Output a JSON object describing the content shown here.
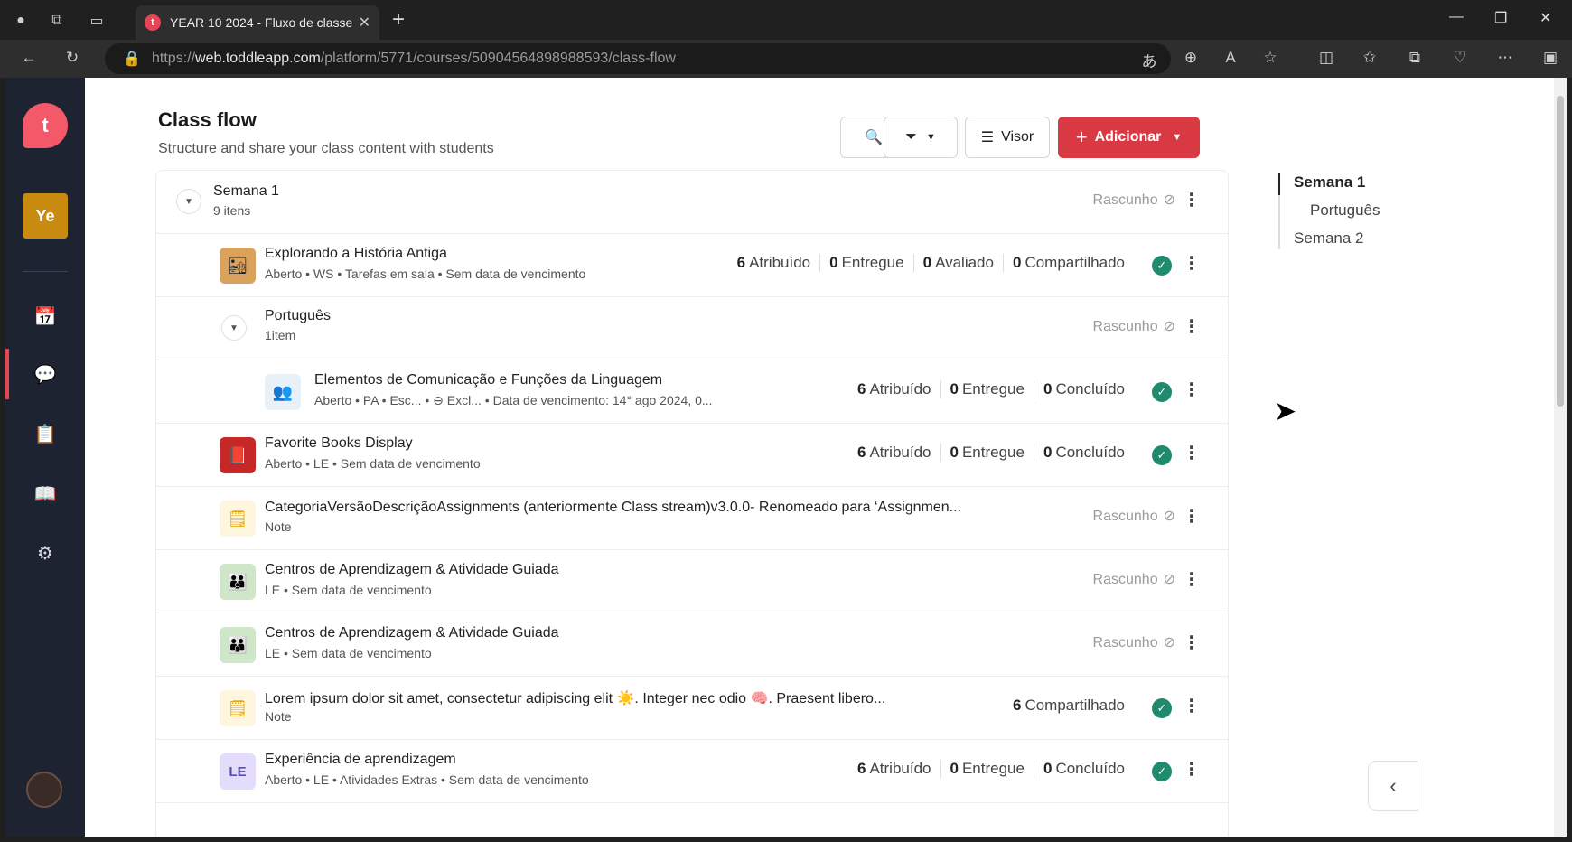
{
  "browser": {
    "tab_title": "YEAR 10 2024 - Fluxo de classe",
    "tab_favicon": "t",
    "url_prefix": "https://",
    "url_domain": "web.toddleapp.com",
    "url_path": "/platform/5771/courses/50904564898988593/class-flow"
  },
  "sidebar": {
    "logo": "t",
    "class_badge": "Ye"
  },
  "header": {
    "title": "Class flow",
    "subtitle": "Structure and share your class content with students",
    "visor_label": "Visor",
    "add_label": "Adicionar"
  },
  "rows": [
    {
      "kind": "section",
      "title": "Semana 1",
      "sub": "9 itens",
      "status": "Rascunho"
    },
    {
      "kind": "item",
      "title": "Explorando a História Antiga",
      "sub": "Aberto • WS • Tarefas em sala • Sem data de vencimento",
      "stats": [
        [
          "6",
          "Atribuído"
        ],
        [
          "0",
          "Entregue"
        ],
        [
          "0",
          "Avaliado"
        ],
        [
          "0",
          "Compartilhado"
        ]
      ]
    },
    {
      "kind": "subsection",
      "title": "Português",
      "sub": "1item",
      "status": "Rascunho"
    },
    {
      "kind": "item",
      "title": "Elementos de Comunicação e Funções da Linguagem",
      "sub": "Aberto • PA • Esc... • ⊖ Excl... • Data de vencimento: 14° ago 2024, 0...",
      "stats": [
        [
          "6",
          "Atribuído"
        ],
        [
          "0",
          "Entregue"
        ],
        [
          "0",
          "Concluído"
        ]
      ]
    },
    {
      "kind": "item",
      "title": "Favorite Books Display",
      "sub": "Aberto • LE • Sem data de vencimento",
      "stats": [
        [
          "6",
          "Atribuído"
        ],
        [
          "0",
          "Entregue"
        ],
        [
          "0",
          "Concluído"
        ]
      ]
    },
    {
      "kind": "note",
      "title": "CategoriaVersãoDescriçãoAssignments (anteriormente Class stream)v3.0.0- Renomeado para ‘Assignmen...",
      "sub": "Note",
      "status": "Rascunho"
    },
    {
      "kind": "item",
      "title": "Centros de Aprendizagem & Atividade Guiada",
      "sub": "LE • Sem data de vencimento",
      "status": "Rascunho"
    },
    {
      "kind": "item",
      "title": "Centros de Aprendizagem & Atividade Guiada",
      "sub": "LE • Sem data de vencimento",
      "status": "Rascunho"
    },
    {
      "kind": "note",
      "title": "Lorem ipsum dolor sit amet, consectetur adipiscing elit ☀️. Integer nec odio 🧠. Praesent libero...",
      "sub": "Note",
      "stats": [
        [
          "6",
          "Compartilhado"
        ]
      ]
    },
    {
      "kind": "item",
      "title": "Experiência de aprendizagem",
      "sub": "Aberto • LE • Atividades Extras • Sem data de vencimento",
      "thumb_text": "LE",
      "stats": [
        [
          "6",
          "Atribuído"
        ],
        [
          "0",
          "Entregue"
        ],
        [
          "0",
          "Concluído"
        ]
      ]
    }
  ],
  "toc": [
    "Semana 1",
    "Português",
    "Semana 2"
  ],
  "colors": {
    "accent": "#d93943",
    "check": "#1f8a6e",
    "sidebar": "#1d2330"
  }
}
